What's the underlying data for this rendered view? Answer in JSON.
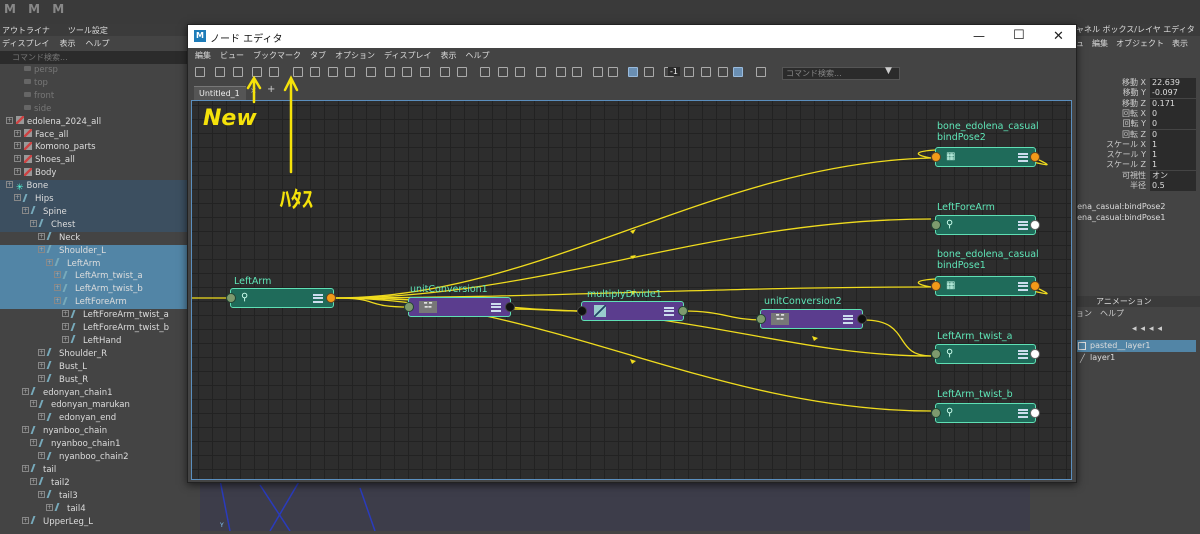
{
  "app": {
    "logo": "M M M"
  },
  "outliner": {
    "tabs": [
      "アウトライナ",
      "ツール設定"
    ],
    "menu": [
      "ディスプレイ",
      "表示",
      "ヘルプ"
    ],
    "search_placeholder": "コマンド検索...",
    "items": [
      {
        "label": "persp",
        "depth": 1,
        "icon": "camera-icon",
        "state": "dim"
      },
      {
        "label": "top",
        "depth": 1,
        "icon": "camera-icon",
        "state": "dim"
      },
      {
        "label": "front",
        "depth": 1,
        "icon": "camera-icon",
        "state": "dim"
      },
      {
        "label": "side",
        "depth": 1,
        "icon": "camera-icon",
        "state": "dim"
      },
      {
        "label": "edolena_2024_all",
        "depth": 0,
        "icon": "group-icon",
        "state": ""
      },
      {
        "label": "Face_all",
        "depth": 1,
        "icon": "group-icon",
        "state": ""
      },
      {
        "label": "Komono_parts",
        "depth": 1,
        "icon": "group-icon",
        "state": ""
      },
      {
        "label": "Shoes_all",
        "depth": 1,
        "icon": "group-icon",
        "state": ""
      },
      {
        "label": "Body",
        "depth": 1,
        "icon": "group-icon",
        "state": ""
      },
      {
        "label": "Bone",
        "depth": 0,
        "icon": "bone-icon",
        "state": "hl"
      },
      {
        "label": "Hips",
        "depth": 1,
        "icon": "joint-icon",
        "state": "hl"
      },
      {
        "label": "Spine",
        "depth": 2,
        "icon": "joint-icon",
        "state": "hl"
      },
      {
        "label": "Chest",
        "depth": 3,
        "icon": "joint-icon",
        "state": "hl"
      },
      {
        "label": "Neck",
        "depth": 4,
        "icon": "joint-icon",
        "state": ""
      },
      {
        "label": "Shoulder_L",
        "depth": 4,
        "icon": "joint-icon",
        "state": "sel"
      },
      {
        "label": "LeftArm",
        "depth": 5,
        "icon": "joint-icon",
        "state": "sel"
      },
      {
        "label": "LeftArm_twist_a",
        "depth": 6,
        "icon": "joint-icon",
        "state": "sel"
      },
      {
        "label": "LeftArm_twist_b",
        "depth": 6,
        "icon": "joint-icon",
        "state": "sel"
      },
      {
        "label": "LeftForeArm",
        "depth": 6,
        "icon": "joint-icon",
        "state": "sel"
      },
      {
        "label": "LeftForeArm_twist_a",
        "depth": 7,
        "icon": "joint-icon",
        "state": ""
      },
      {
        "label": "LeftForeArm_twist_b",
        "depth": 7,
        "icon": "joint-icon",
        "state": ""
      },
      {
        "label": "LeftHand",
        "depth": 7,
        "icon": "joint-icon",
        "state": ""
      },
      {
        "label": "Shoulder_R",
        "depth": 4,
        "icon": "joint-icon",
        "state": ""
      },
      {
        "label": "Bust_L",
        "depth": 4,
        "icon": "joint-icon",
        "state": ""
      },
      {
        "label": "Bust_R",
        "depth": 4,
        "icon": "joint-icon",
        "state": ""
      },
      {
        "label": "edonyan_chain1",
        "depth": 2,
        "icon": "joint-icon",
        "state": ""
      },
      {
        "label": "edonyan_marukan",
        "depth": 3,
        "icon": "joint-icon",
        "state": ""
      },
      {
        "label": "edonyan_end",
        "depth": 4,
        "icon": "joint-icon",
        "state": ""
      },
      {
        "label": "nyanboo_chain",
        "depth": 2,
        "icon": "joint-icon",
        "state": ""
      },
      {
        "label": "nyanboo_chain1",
        "depth": 3,
        "icon": "joint-icon",
        "state": ""
      },
      {
        "label": "nyanboo_chain2",
        "depth": 4,
        "icon": "joint-icon",
        "state": ""
      },
      {
        "label": "tail",
        "depth": 2,
        "icon": "joint-icon",
        "state": ""
      },
      {
        "label": "tail2",
        "depth": 3,
        "icon": "joint-icon",
        "state": ""
      },
      {
        "label": "tail3",
        "depth": 4,
        "icon": "joint-icon",
        "state": ""
      },
      {
        "label": "tail4",
        "depth": 5,
        "icon": "joint-icon",
        "state": ""
      },
      {
        "label": "UpperLeg_L",
        "depth": 2,
        "icon": "joint-icon",
        "state": ""
      }
    ]
  },
  "right_panel": {
    "title": "ャネル ボックス/レイヤ エディタ",
    "menu": [
      "ュ",
      "編集",
      "オブジェクト",
      "表示"
    ],
    "attributes": [
      {
        "label": "移動 X",
        "value": "22.639"
      },
      {
        "label": "移動 Y",
        "value": "-0.097"
      },
      {
        "label": "移動 Z",
        "value": "0.171"
      },
      {
        "label": "回転 X",
        "value": "0"
      },
      {
        "label": "回転 Y",
        "value": "0"
      },
      {
        "label": "回転 Z",
        "value": "0"
      },
      {
        "label": "スケール X",
        "value": "1"
      },
      {
        "label": "スケール Y",
        "value": "1"
      },
      {
        "label": "スケール Z",
        "value": "1"
      },
      {
        "label": "可視性",
        "value": "オン"
      },
      {
        "label": "半径",
        "value": "0.5"
      }
    ],
    "connections": [
      "-lena_casual:bindPose2",
      "-lena_casual:bindPose1"
    ],
    "anim_tab": "アニメーション",
    "anim_menu": [
      "ョン",
      "ヘルプ"
    ],
    "layers": [
      "pasted__layer1",
      "layer1"
    ]
  },
  "node_editor": {
    "title": "ノード エディタ",
    "menu": [
      "編集",
      "ビュー",
      "ブックマーク",
      "タブ",
      "オプション",
      "ディスプレイ",
      "表示",
      "ヘルプ"
    ],
    "search_placeholder": "コマンド検索...",
    "toolbar_value": "-1",
    "tab": "Untitled_1",
    "tab_add": "+",
    "nodes": {
      "leftarm": "LeftArm",
      "unitconv1": "unitConversion1",
      "multdiv": "multiplyDivide1",
      "unitconv2": "unitConversion2",
      "bindpose2": "bone_edolena_casual\nbindPose2",
      "leftforearm": "LeftForeArm",
      "bindpose1": "bone_edolena_casual\nbindPose1",
      "twist_a": "LeftArm_twist_a",
      "twist_b": "LeftArm_twist_b"
    }
  },
  "annotations": {
    "new": "New",
    "other": "ﾊﾀｽ"
  },
  "colors": {
    "accent": "#5fe0b5",
    "connection": "#f5e20a",
    "output_plug": "#f39a19",
    "transform_node": "#1f6b5a",
    "utility_node": "#5b3d8e"
  }
}
